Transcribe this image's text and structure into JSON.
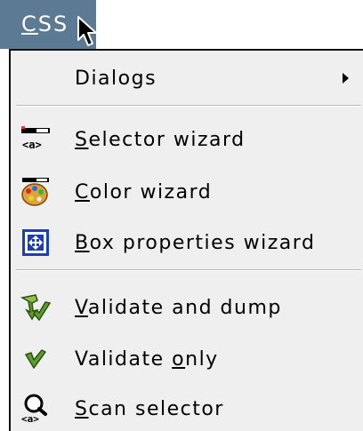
{
  "menubar": {
    "css_menu_label": "CSS",
    "css_menu_label_first": "C",
    "css_menu_label_rest": "SS"
  },
  "menu": {
    "dialogs": {
      "label": "Dialogs"
    },
    "selector_wizard": {
      "mnemonic": "S",
      "rest": "elector wizard",
      "icon": "selector-wizard-icon"
    },
    "color_wizard": {
      "mnemonic": "C",
      "rest": "olor wizard",
      "icon": "color-wizard-icon"
    },
    "box_properties_wizard": {
      "mnemonic": "B",
      "rest": "ox properties wizard",
      "icon": "box-properties-icon"
    },
    "validate_and_dump": {
      "mnemonic": "V",
      "rest": "alidate and dump",
      "icon": "validate-dump-icon"
    },
    "validate_only": {
      "prefix": "Validate ",
      "mnemonic": "o",
      "rest": "nly",
      "icon": "checkmark-icon"
    },
    "scan_selector": {
      "mnemonic": "S",
      "rest": "can selector",
      "icon": "scan-selector-icon"
    }
  },
  "colors": {
    "menubar_active": "#5c7a93",
    "menu_background": "#efefef",
    "checkmark": "#3c8a3c"
  }
}
